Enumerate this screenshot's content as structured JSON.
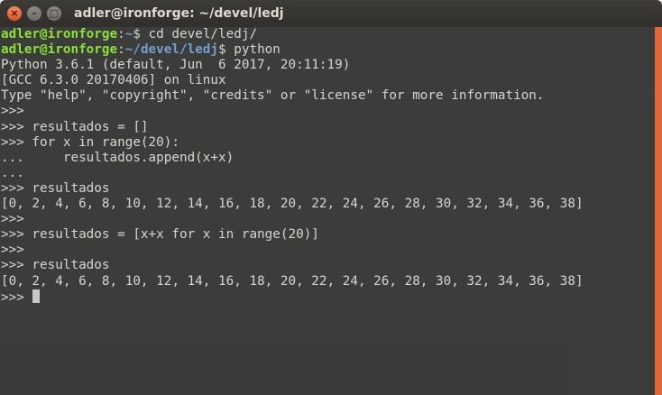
{
  "window": {
    "title": "adler@ironforge: ~/devel/ledj",
    "close_glyph": "×",
    "minimize_glyph": "–",
    "maximize_glyph": "□"
  },
  "terminal": {
    "prompt_user": "adler@ironforge",
    "prompt_sep": ":",
    "prompt_home": "~",
    "prompt_dir": "~/devel/ledj",
    "prompt_end": "$ ",
    "cmd1": "cd devel/ledj/",
    "cmd2": "python",
    "lines": [
      "Python 3.6.1 (default, Jun  6 2017, 20:11:19)",
      "[GCC 6.3.0 20170406] on linux",
      "Type \"help\", \"copyright\", \"credits\" or \"license\" for more information.",
      ">>> ",
      ">>> resultados = []",
      ">>> for x in range(20):",
      "...     resultados.append(x+x)",
      "...",
      ">>> resultados",
      "[0, 2, 4, 6, 8, 10, 12, 14, 16, 18, 20, 22, 24, 26, 28, 30, 32, 34, 36, 38]",
      ">>> ",
      ">>> resultados = [x+x for x in range(20)]",
      ">>> ",
      ">>> resultados",
      "[0, 2, 4, 6, 8, 10, 12, 14, 16, 18, 20, 22, 24, 26, 28, 30, 32, 34, 36, 38]"
    ],
    "last_prompt": ">>> "
  },
  "colors": {
    "prompt_user": "#8ae234",
    "prompt_path": "#729fcf",
    "text": "#d3d7cf",
    "accent": "#e0673a"
  }
}
